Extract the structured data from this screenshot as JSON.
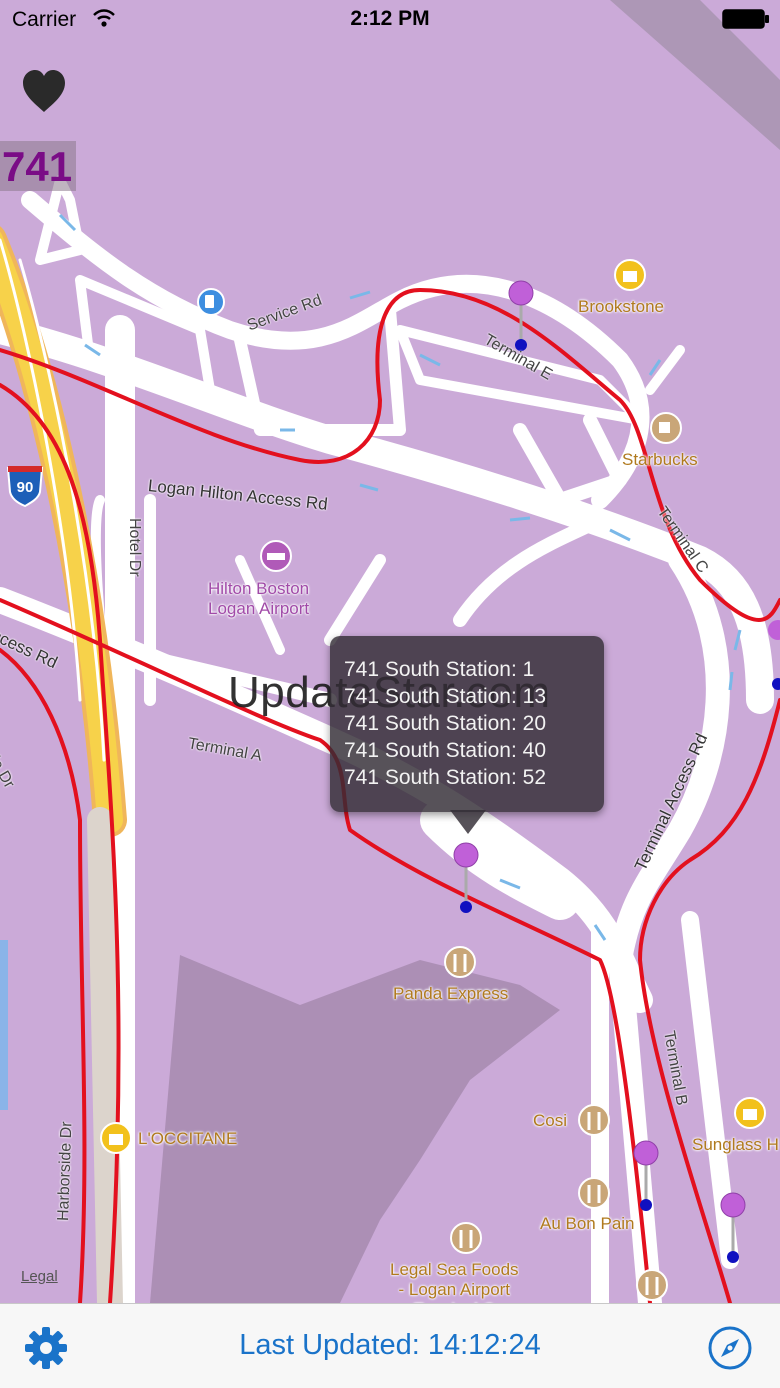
{
  "status_bar": {
    "carrier": "Carrier",
    "time": "2:12 PM"
  },
  "route_number": "741",
  "map": {
    "pois": {
      "brookstone": "Brookstone",
      "starbucks": "Starbucks",
      "hilton": "Hilton Boston\nLogan Airport",
      "panda": "Panda Express",
      "occitane": "L'OCCITANE",
      "cosi": "Cosi",
      "sunglass": "Sunglass H",
      "au_bon_pain": "Au Bon Pain",
      "legal_sea_foods": "Legal Sea Foods\n- Logan Airport\nTerminal C"
    },
    "roads": {
      "service_rd": "Service Rd",
      "terminal_e": "Terminal E",
      "logan_hilton": "Logan Hilton Access Rd",
      "hotel_dr": "Hotel Dr",
      "terminal_a_access": "Terminal A Access Rd",
      "terminal_a": "Terminal A",
      "harborside_dr_top": "Harborside Dr",
      "harborside_dr_bottom": "Harborside Dr",
      "terminal_access_rd": "Terminal Access Rd",
      "terminal_c": "Terminal C",
      "terminal_b": "Terminal B",
      "interstate": "90"
    },
    "legal": "Legal"
  },
  "callout": {
    "rows": [
      "741 South Station: 1",
      "741 South Station: 13",
      "741 South Station: 20",
      "741 South Station: 40",
      "741 South Station: 52"
    ]
  },
  "watermark": "UpdateStar.com",
  "toolbar": {
    "last_updated": "Last Updated: 14:12:24"
  },
  "colors": {
    "map_bg": "#cbaad8",
    "route": "#e3101e",
    "accent": "#1a73c9",
    "highway": "#f5c400"
  },
  "icons": {
    "favorite": "heart-icon",
    "settings": "gear-icon",
    "locate": "compass-icon",
    "pin": "map-pin-icon"
  }
}
